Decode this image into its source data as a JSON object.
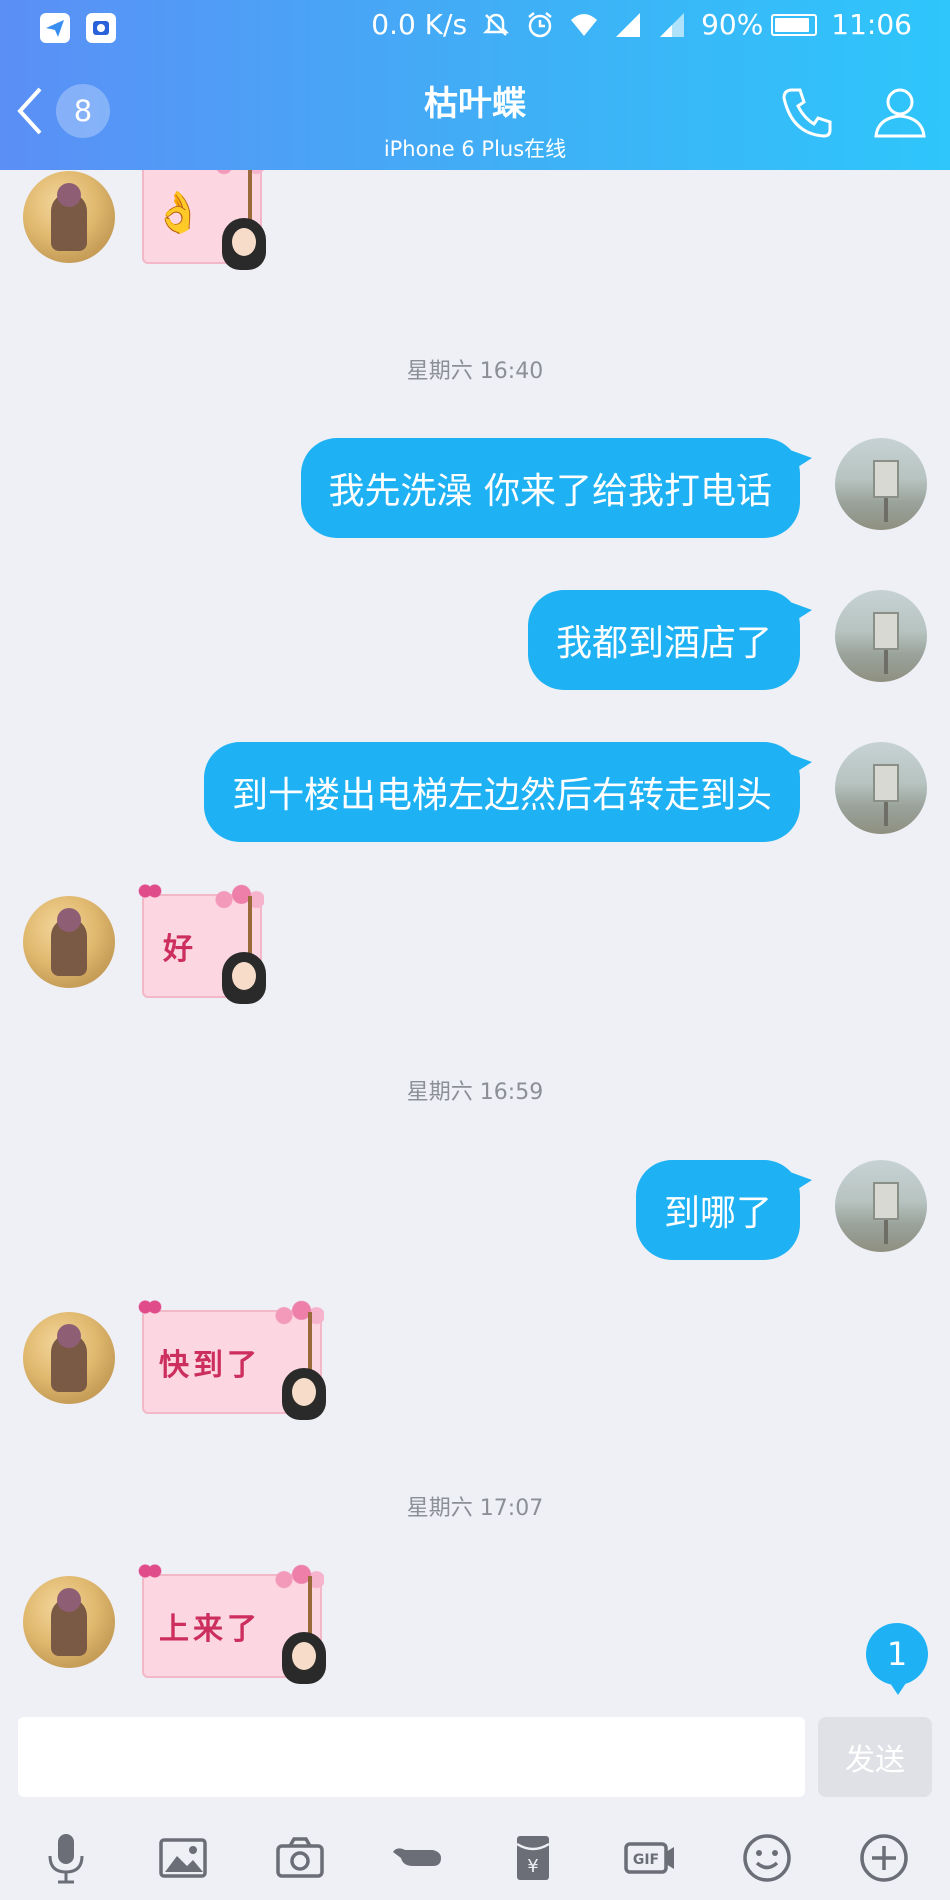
{
  "status_bar": {
    "network_speed": "0.0 K/s",
    "battery_percent": "90%",
    "battery_level": 0.9,
    "time": "11:06"
  },
  "header": {
    "unread_count": "8",
    "contact_name": "枯叶蝶",
    "contact_status": "iPhone 6 Plus在线"
  },
  "messages": [
    {
      "type": "sticker",
      "side": "left",
      "text": "👌"
    },
    {
      "type": "time",
      "text": "星期六 16:40"
    },
    {
      "type": "text",
      "side": "right",
      "text": "我先洗澡  你来了给我打电话"
    },
    {
      "type": "text",
      "side": "right",
      "text": "我都到酒店了"
    },
    {
      "type": "text",
      "side": "right",
      "text": "到十楼出电梯左边然后右转走到头"
    },
    {
      "type": "sticker",
      "side": "left",
      "text": "好"
    },
    {
      "type": "time",
      "text": "星期六 16:59"
    },
    {
      "type": "text",
      "side": "right",
      "text": "到哪了"
    },
    {
      "type": "sticker",
      "side": "left",
      "text": "快到了"
    },
    {
      "type": "time",
      "text": "星期六 17:07"
    },
    {
      "type": "sticker",
      "side": "left",
      "text": "上来了"
    }
  ],
  "new_message_badge": "1",
  "composer": {
    "input_value": "",
    "send_label": "发送"
  },
  "toolbar": {
    "icons": [
      "microphone-icon",
      "image-icon",
      "camera-icon",
      "poke-icon",
      "red-packet-icon",
      "gif-icon",
      "emoji-icon",
      "plus-icon"
    ]
  },
  "colors": {
    "header_gradient_start": "#5b8ff6",
    "header_gradient_end": "#2ec6fb",
    "bubble_blue": "#1eb2f4",
    "background": "#eef0f6"
  }
}
